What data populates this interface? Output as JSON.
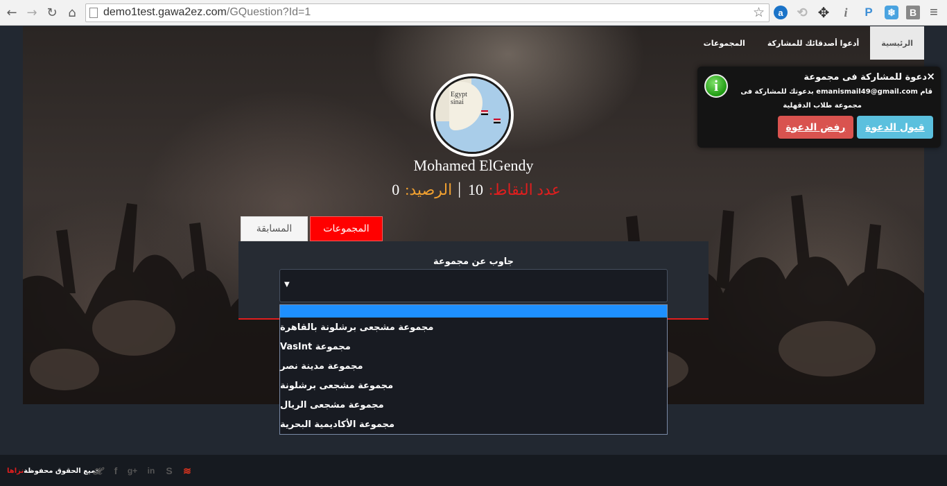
{
  "browser": {
    "url_host": "demo1test.gawa2ez.com",
    "url_path": "/GQuestion?Id=1"
  },
  "nav": {
    "items": [
      {
        "label": "الرئيسية",
        "active": true
      },
      {
        "label": "أدعوا أصدقائك للمشاركة",
        "active": false
      },
      {
        "label": "المجموعات",
        "active": false
      }
    ]
  },
  "avatar": {
    "map_label_country": "Egypt",
    "map_label_region": "sinai"
  },
  "profile": {
    "name": "Mohamed ElGendy",
    "points_label": "عدد النقاط:",
    "points_value": "10",
    "separator": "|",
    "balance_label": "الرصيد:",
    "balance_value": "0"
  },
  "tabs": {
    "groups_label": "المجموعات",
    "contest_label": "المسابقة"
  },
  "panel": {
    "label": "جاوب عن مجموعة",
    "select_value": ""
  },
  "dropdown": {
    "options": [
      "",
      "مجموعة مشجعى برشلونة بالقاهرة",
      "مجموعة VasInt",
      "مجموعة مدينة نصر",
      "مجموعة مشجعى برشلونة",
      "مجموعة مشجعى الريال",
      "مجموعة الأكاديمية البحرية"
    ],
    "highlighted_index": 0
  },
  "notification": {
    "title": "دعوة للمشاركة فى مجموعة",
    "line1": "قام emanismail49@gmail.com بدعوتك للمشاركة فى",
    "line2": "مجموعة طلاب الدقهلية",
    "accept_label": "قبول الدعوة",
    "reject_label": "رفض الدعوة",
    "close_glyph": "×"
  },
  "footer": {
    "brand": "نزاها",
    "rights": "جميع الحقوق محفوظة"
  },
  "colors": {
    "accent_red": "#ff0000",
    "balance_orange": "#f0a030",
    "accept_blue": "#5bc0de",
    "reject_red": "#d9534f",
    "highlight_blue": "#1e90ff"
  }
}
